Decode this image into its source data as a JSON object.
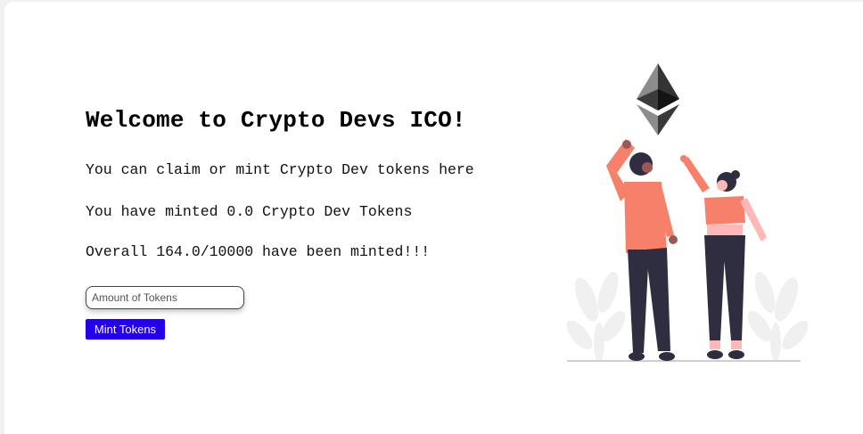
{
  "main": {
    "title": "Welcome to Crypto Devs ICO!",
    "description": "You can claim or mint Crypto Dev tokens here",
    "minted_text": "You have minted 0.0 Crypto Dev Tokens",
    "overall_text": "Overall 164.0/10000 have been minted!!!",
    "amount_input": {
      "placeholder": "Amount of Tokens",
      "value": ""
    },
    "mint_button_label": "Mint Tokens"
  },
  "illustration": {
    "name": "ethereum-people-illustration",
    "colors": {
      "shirt": "#f7806a",
      "pants": "#2f2e41",
      "eth_dark": "#343434",
      "eth_light": "#8c8c8c",
      "plants": "#f0f0f0"
    }
  },
  "colors": {
    "button_bg": "#2500e6",
    "button_text": "#ffffff",
    "page_bg": "#ffffff"
  }
}
